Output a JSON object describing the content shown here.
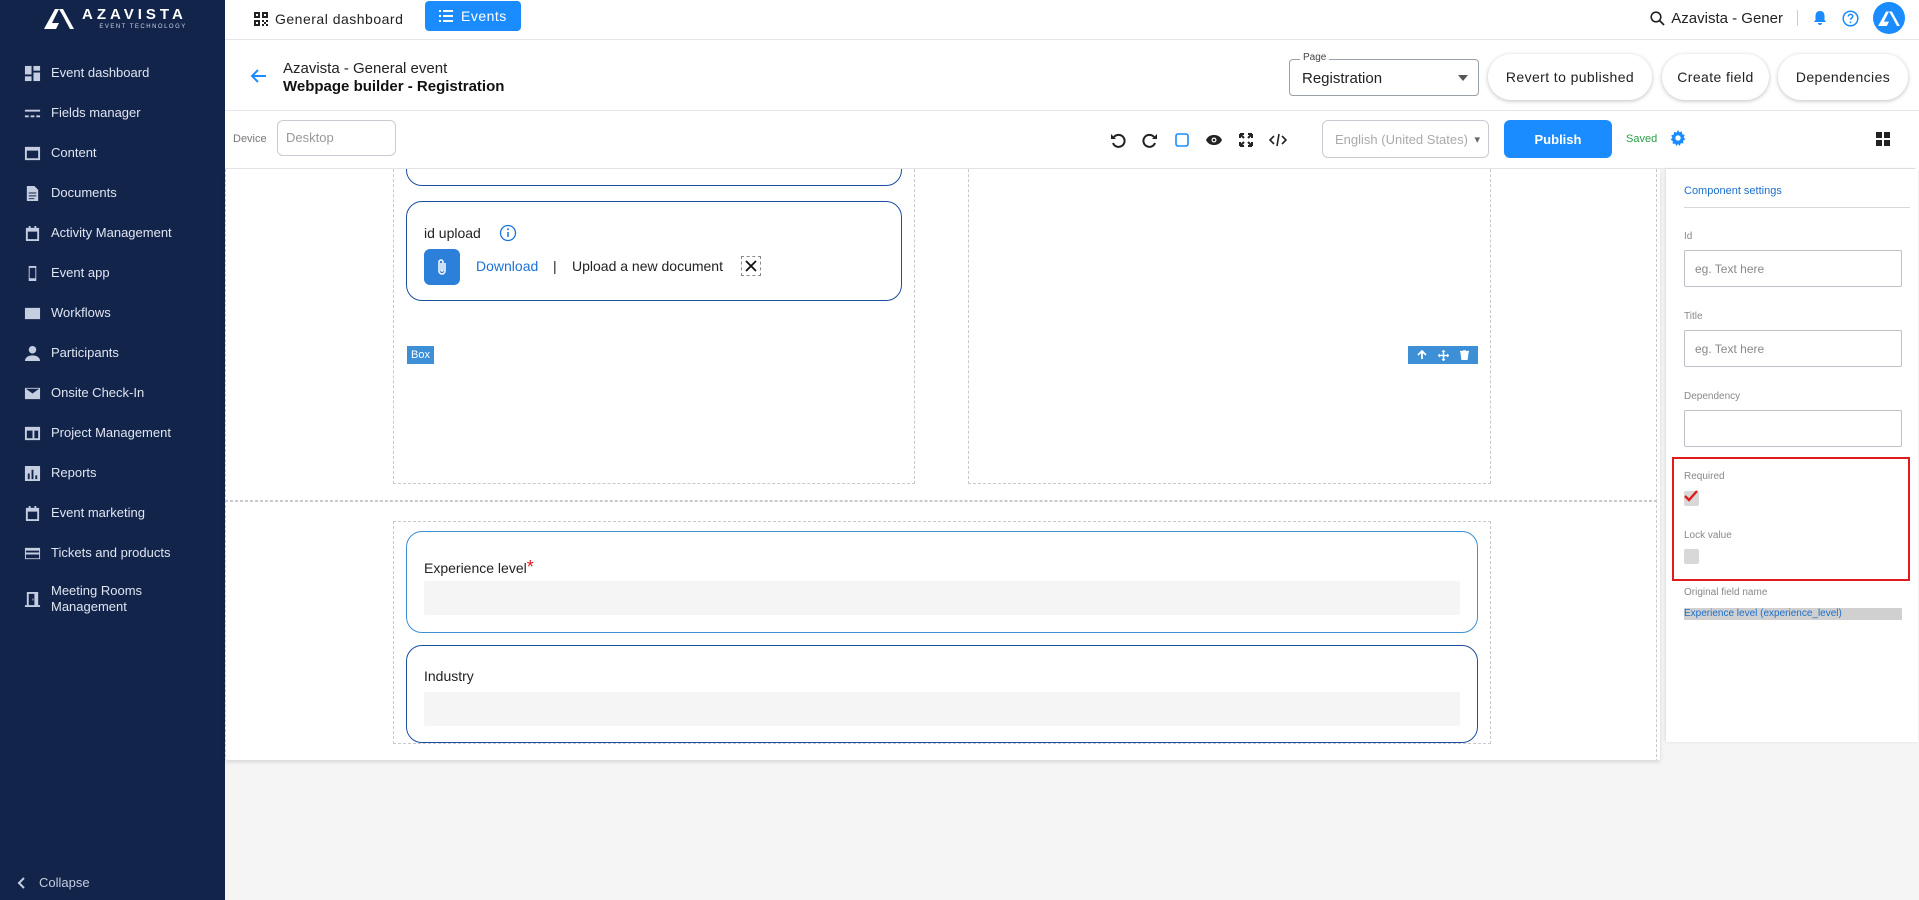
{
  "brand": {
    "name": "AZAVISTA",
    "tagline": "EVENT TECHNOLOGY"
  },
  "sidebar": {
    "items": [
      {
        "label": "Event dashboard",
        "icon": "dashboard-icon"
      },
      {
        "label": "Fields manager",
        "icon": "fields-icon"
      },
      {
        "label": "Content",
        "icon": "content-icon"
      },
      {
        "label": "Documents",
        "icon": "document-icon"
      },
      {
        "label": "Activity Management",
        "icon": "calendar-icon"
      },
      {
        "label": "Event app",
        "icon": "phone-icon"
      },
      {
        "label": "Workflows",
        "icon": "workflow-icon"
      },
      {
        "label": "Participants",
        "icon": "person-icon"
      },
      {
        "label": "Onsite Check-In",
        "icon": "mail-icon"
      },
      {
        "label": "Project Management",
        "icon": "project-icon"
      },
      {
        "label": "Reports",
        "icon": "chart-icon"
      },
      {
        "label": "Event marketing",
        "icon": "calendar-icon"
      },
      {
        "label": "Tickets and products",
        "icon": "card-icon"
      },
      {
        "label": "Meeting Rooms Management",
        "icon": "room-icon"
      }
    ],
    "collapse_label": "Collapse"
  },
  "topbar": {
    "tab_dashboard": "General dashboard",
    "tab_events": "Events",
    "search_text": "Azavista - Gener"
  },
  "header": {
    "event_name": "Azavista - General event",
    "page_title": "Webpage builder - Registration",
    "page_select_legend": "Page",
    "page_select_value": "Registration",
    "btn_revert": "Revert to published",
    "btn_create": "Create field",
    "btn_dependencies": "Dependencies"
  },
  "toolbar": {
    "device_label": "Device",
    "device_placeholder": "Desktop",
    "language_value": "English (United States)",
    "publish_label": "Publish",
    "saved_label": "Saved"
  },
  "canvas": {
    "upload_field": {
      "label": "id upload",
      "download": "Download",
      "separator": "|",
      "upload_new": "Upload a new document"
    },
    "box_tag": "Box",
    "experience_field": {
      "label": "Experience level",
      "required_mark": "*"
    },
    "industry_field": {
      "label": "Industry"
    }
  },
  "settings_panel": {
    "title": "Component settings",
    "id_label": "Id",
    "id_placeholder": "eg. Text here",
    "title_label": "Title",
    "title_placeholder": "eg. Text here",
    "dependency_label": "Dependency",
    "required_label": "Required",
    "required_checked": true,
    "lock_label": "Lock value",
    "lock_checked": false,
    "original_field_label": "Original field name",
    "original_field_value": "Experience level (experience_level)"
  },
  "colors": {
    "sidebar_bg": "#13244a",
    "accent": "#1a8cff",
    "field_border": "#1c4fa0",
    "highlight": "#e01b1b",
    "saved": "#2a9d43"
  }
}
